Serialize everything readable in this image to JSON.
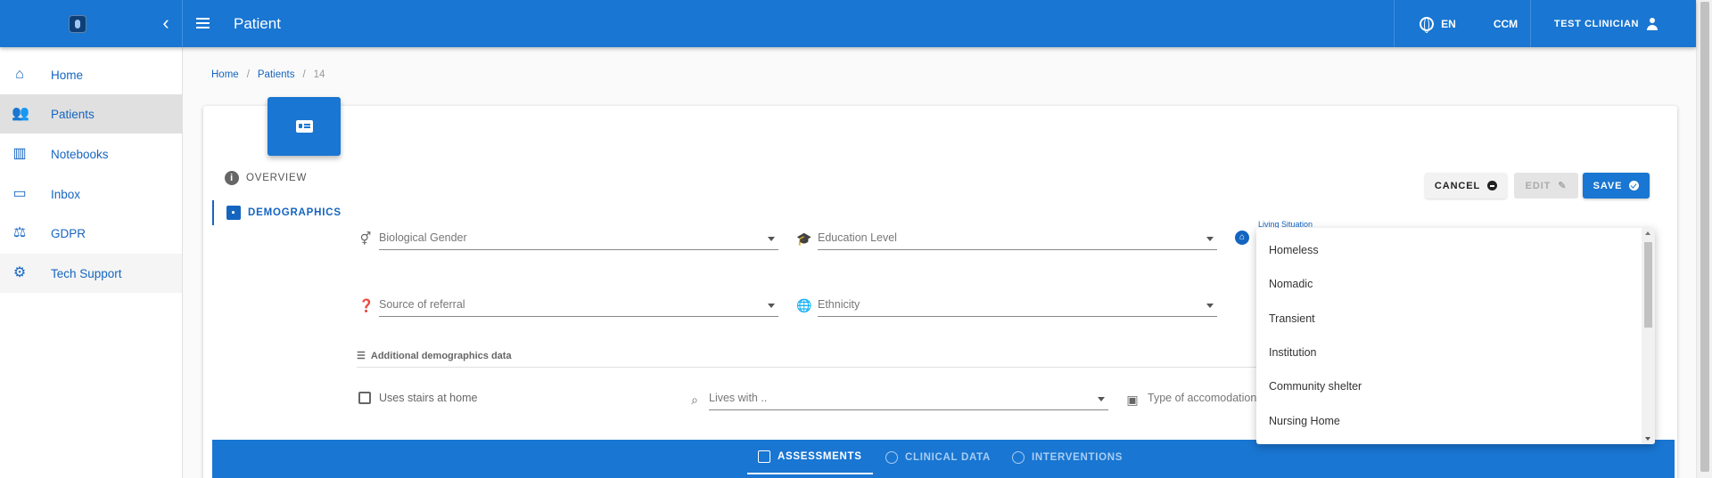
{
  "topbar": {
    "title": "Patient",
    "language": "EN",
    "ccm": "CCM",
    "user": "TEST CLINICIAN"
  },
  "sidebar": {
    "items": [
      {
        "label": "Home",
        "icon": "home-icon"
      },
      {
        "label": "Patients",
        "icon": "people-icon"
      },
      {
        "label": "Notebooks",
        "icon": "bar-chart-icon"
      },
      {
        "label": "Inbox",
        "icon": "inbox-icon"
      },
      {
        "label": "GDPR",
        "icon": "gavel-icon"
      },
      {
        "label": "Tech Support",
        "icon": "support-icon"
      }
    ]
  },
  "breadcrumb": {
    "home": "Home",
    "patients": "Patients",
    "current": "14"
  },
  "tabs": {
    "overview": "OVERVIEW",
    "demographics": "DEMOGRAPHICS"
  },
  "actions": {
    "cancel": "CANCEL",
    "edit": "EDIT",
    "save": "SAVE"
  },
  "form": {
    "biological_gender": "Biological Gender",
    "education_level": "Education Level",
    "living_situation": "Living Situation",
    "source_of_referral": "Source of referral",
    "ethnicity": "Ethnicity",
    "additional_section": "Additional demographics data",
    "uses_stairs": "Uses stairs at home",
    "lives_with": "Lives with ..",
    "accommodation": "Type of accomodation"
  },
  "living_options": [
    "Homeless",
    "Nomadic",
    "Transient",
    "Institution",
    "Community shelter",
    "Nursing Home"
  ],
  "bottom_tabs": {
    "assessments": "ASSESSMENTS",
    "clinical_data": "CLINICAL DATA",
    "interventions": "INTERVENTIONS"
  },
  "colors": {
    "primary": "#1976d2",
    "active_nav": "#e0e0e0"
  }
}
